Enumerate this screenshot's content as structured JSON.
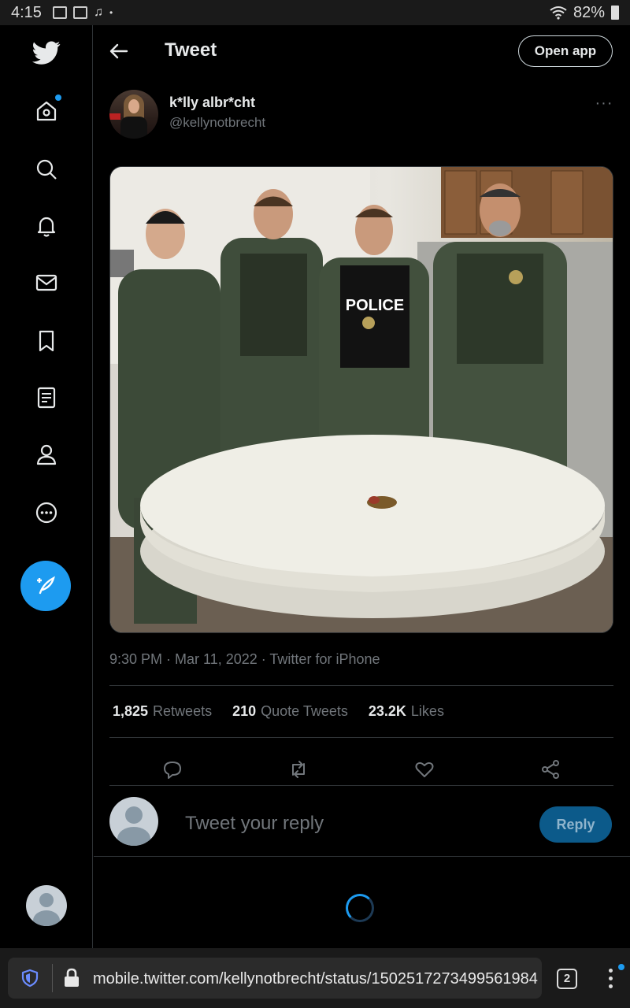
{
  "status_bar": {
    "time": "4:15",
    "battery": "82%"
  },
  "header": {
    "title": "Tweet",
    "open_app": "Open app"
  },
  "tweet": {
    "display_name": "k*lly albr*cht",
    "handle": "@kellynotbrecht",
    "more": "···",
    "media_text": "POLICE",
    "meta": "9:30 PM · Mar 11, 2022 · Twitter for iPhone",
    "stats": [
      {
        "count": "1,825",
        "label": "Retweets"
      },
      {
        "count": "210",
        "label": "Quote Tweets"
      },
      {
        "count": "23.2K",
        "label": "Likes"
      }
    ]
  },
  "reply": {
    "placeholder": "Tweet your reply",
    "button": "Reply"
  },
  "browser": {
    "url": "mobile.twitter.com/kellynotbrecht/status/1502517273499561984",
    "tab_count": "2"
  },
  "colors": {
    "accent": "#1d9bf0",
    "background": "#000000",
    "muted": "#71767b",
    "border": "#2f3336"
  }
}
